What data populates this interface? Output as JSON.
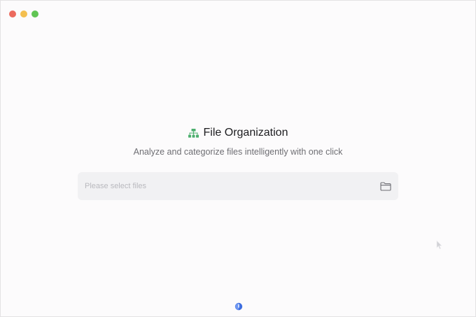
{
  "window": {
    "controls": [
      "close",
      "minimize",
      "zoom"
    ]
  },
  "hero": {
    "icon": "sitemap-icon",
    "title": "File Organization",
    "subtitle": "Analyze and categorize files intelligently with one click"
  },
  "file_picker": {
    "placeholder": "Please select files",
    "icon": "folder-icon"
  },
  "footer": {
    "icon": "app-logo-icon"
  },
  "colors": {
    "accent_green": "#4caf6e",
    "logo_blue": "#3f6fe0",
    "close": "#ec6a5e",
    "minimize": "#f4bf4f",
    "zoom": "#61c554"
  }
}
